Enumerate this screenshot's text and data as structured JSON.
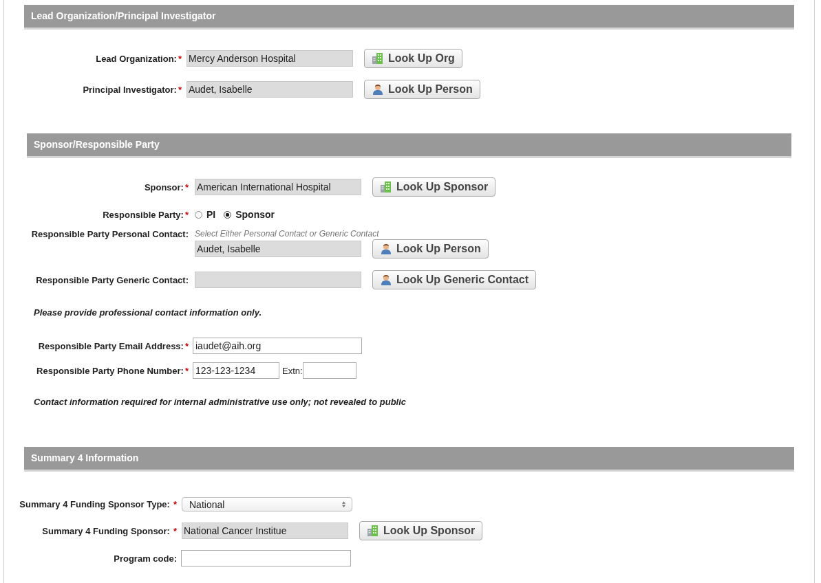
{
  "sections": [
    {
      "title": "Lead Organization/Principal Investigator",
      "rows": [
        {
          "kind": "lookup",
          "label": "Lead Organization:",
          "marker": "*",
          "value": "Mercy Anderson Hospital",
          "button": {
            "label": "Look Up Org",
            "kind": "building"
          }
        },
        {
          "kind": "lookup",
          "label": "Principal Investigator:",
          "marker": "*",
          "value": "Audet, Isabelle",
          "button": {
            "label": "Look Up Person",
            "kind": "person"
          }
        }
      ]
    },
    {
      "title": "Sponsor/Responsible Party",
      "rows": [
        {
          "kind": "lookup",
          "label": "Sponsor:",
          "marker": "*",
          "value": "American International Hospital",
          "button": {
            "label": "Look Up Sponsor",
            "kind": "building"
          }
        },
        {
          "kind": "radio",
          "label": "Responsible Party:",
          "marker": "*",
          "options": [
            {
              "label": "PI",
              "selected": false
            },
            {
              "label": "Sponsor",
              "selected": true
            }
          ]
        },
        {
          "kind": "lookup",
          "label": "Responsible Party Personal Contact:",
          "hint": "Select Either Personal Contact or Generic Contact",
          "value": "Audet, Isabelle",
          "button": {
            "label": "Look Up Person",
            "kind": "person"
          }
        },
        {
          "kind": "lookup",
          "label": "Responsible Party Generic Contact:",
          "button": {
            "label": "Look Up Generic Contact",
            "kind": "person"
          }
        },
        {
          "kind": "note",
          "text": "Please provide professional contact information only."
        },
        {
          "kind": "text",
          "label": "Responsible Party Email Address:",
          "marker": "*",
          "value": "iaudet@aih.org"
        },
        {
          "kind": "phone",
          "label": "Responsible Party Phone Number:",
          "marker": "*",
          "value": "123-123-1234",
          "ext_label": "Extn:"
        },
        {
          "kind": "note",
          "text": "Contact information required for internal administrative use only; not revealed to public"
        }
      ]
    },
    {
      "title": "Summary 4 Information",
      "rows": [
        {
          "kind": "select",
          "label": "Summary 4 Funding Sponsor Type:",
          "marker": "*",
          "value": "National"
        },
        {
          "kind": "lookup",
          "label": "Summary 4 Funding Sponsor:",
          "marker": "*",
          "value": "National Cancer Institue",
          "button": {
            "label": "Look Up Sponsor",
            "kind": "building"
          }
        },
        {
          "kind": "text",
          "label": "Program code:"
        }
      ]
    }
  ]
}
